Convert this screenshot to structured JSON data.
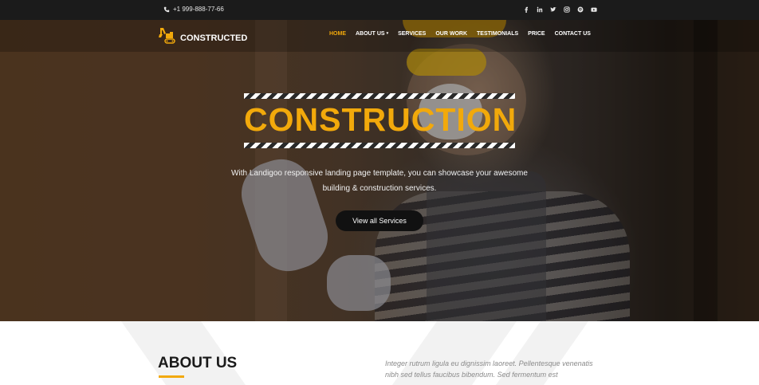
{
  "topbar": {
    "phone": "+1 999-888-77-66",
    "socials": [
      "facebook-icon",
      "linkedin-icon",
      "twitter-icon",
      "instagram-icon",
      "pinterest-icon",
      "youtube-icon"
    ]
  },
  "brand": {
    "name": "CONSTRUCTED"
  },
  "nav": {
    "items": [
      {
        "label": "HOME",
        "active": true
      },
      {
        "label": "ABOUT US",
        "dropdown": true
      },
      {
        "label": "SERVICES"
      },
      {
        "label": "OUR WORK"
      },
      {
        "label": "TESTIMONIALS"
      },
      {
        "label": "PRICE"
      },
      {
        "label": "CONTACT US"
      }
    ]
  },
  "hero": {
    "title": "CONSTRUCTION",
    "description": "With Landigoo responsive landing page template, you can showcase your awesome building & construction services.",
    "button_label": "View all Services"
  },
  "about": {
    "title": "ABOUT US",
    "text": "Integer rutrum ligula eu dignissim laoreet. Pellentesque venenatis nibh sed tellus faucibus bibendum. Sed fermentum est"
  },
  "colors": {
    "accent": "#f2a90b",
    "topbar": "#1b1b1b",
    "button": "#111111"
  }
}
